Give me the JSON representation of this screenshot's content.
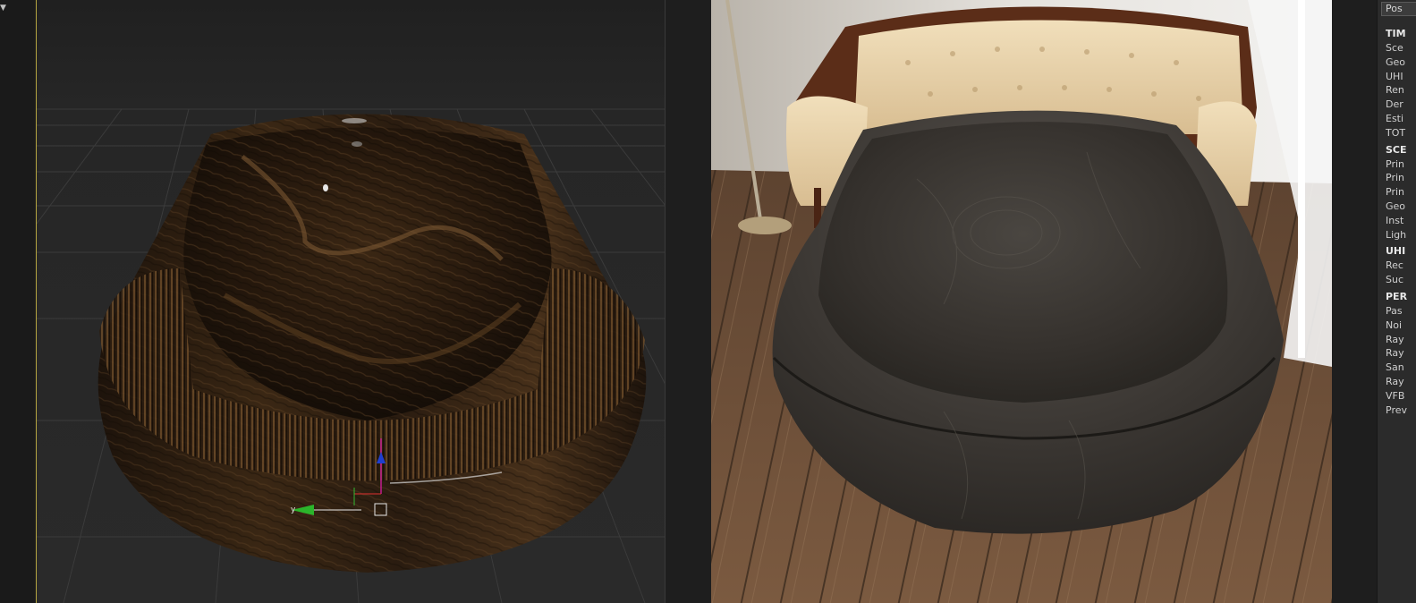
{
  "viewport": {
    "axis_label": "y"
  },
  "stats_panel": {
    "tab_label": "Pos",
    "sections": [
      {
        "header": "TIM",
        "rows": [
          "Sce",
          "Geo",
          "UHI",
          "Ren",
          "Der",
          "Esti",
          "TOT"
        ]
      },
      {
        "header": "SCE",
        "rows": [
          "Prin",
          "Prin",
          "Prin",
          "Geo",
          "Inst",
          "Ligh"
        ]
      },
      {
        "header": "UHI",
        "rows": [
          "Rec",
          "Suc"
        ]
      },
      {
        "header": "PER",
        "rows": [
          "Pas",
          "Noi",
          "Ray",
          "Ray",
          "San",
          "Ray",
          "VFB",
          "Prev"
        ]
      }
    ]
  },
  "colors": {
    "viewport_border": "#b6a641",
    "wood_dark": "#2a1a0e",
    "wood_light": "#6b4a2a",
    "render_tub": "#3b3733",
    "floor": "#6e5038"
  }
}
